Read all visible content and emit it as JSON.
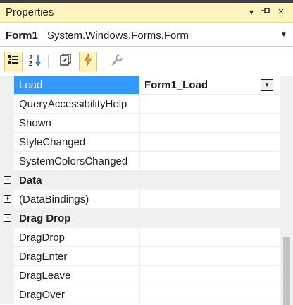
{
  "titlebar": {
    "title": "Properties",
    "dropdown_glyph": "▾",
    "pin_glyph": "⊣",
    "close_glyph": "×"
  },
  "object_selector": {
    "name": "Form1",
    "type": "System.Windows.Forms.Form",
    "arrow": "▼"
  },
  "toolbar": {
    "buttons": [
      {
        "icon": "categorized-icon",
        "active": true
      },
      {
        "icon": "alphabetical-icon",
        "active": false
      },
      {
        "icon": "properties-icon",
        "active": false
      },
      {
        "icon": "events-icon",
        "active": true
      },
      {
        "icon": "property-pages-icon",
        "active": false
      }
    ]
  },
  "grid": {
    "rows": [
      {
        "kind": "item",
        "name": "Load",
        "value": "Form1_Load",
        "selected": true
      },
      {
        "kind": "item",
        "name": "QueryAccessibilityHelp",
        "value": ""
      },
      {
        "kind": "item",
        "name": "Shown",
        "value": ""
      },
      {
        "kind": "item",
        "name": "StyleChanged",
        "value": ""
      },
      {
        "kind": "item",
        "name": "SystemColorsChanged",
        "value": ""
      },
      {
        "kind": "category",
        "name": "Data",
        "toggle": "−"
      },
      {
        "kind": "item",
        "name": "(DataBindings)",
        "value": "",
        "expand": "+"
      },
      {
        "kind": "category",
        "name": "Drag Drop",
        "toggle": "−"
      },
      {
        "kind": "item",
        "name": "DragDrop",
        "value": ""
      },
      {
        "kind": "item",
        "name": "DragEnter",
        "value": ""
      },
      {
        "kind": "item",
        "name": "DragLeave",
        "value": ""
      },
      {
        "kind": "item",
        "name": "DragOver",
        "value": ""
      }
    ],
    "value_dropdown_glyph": "▼"
  }
}
